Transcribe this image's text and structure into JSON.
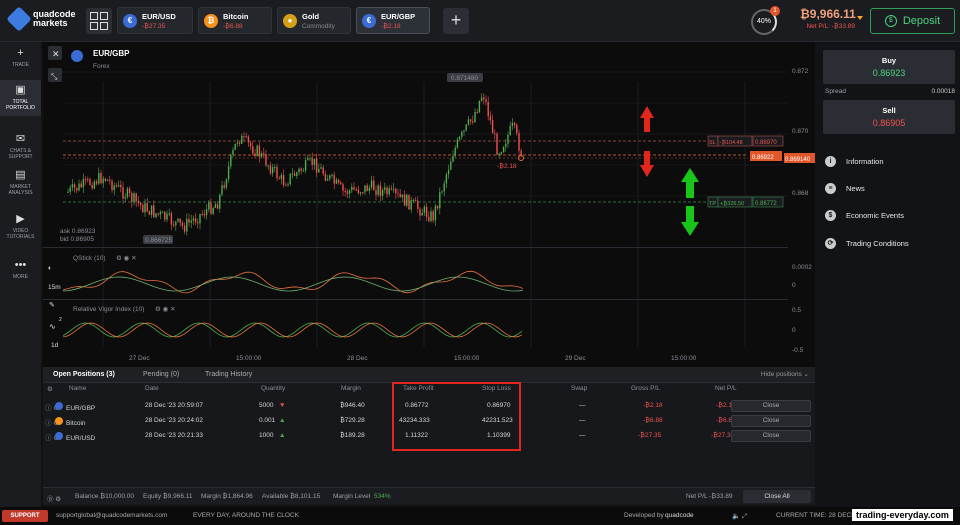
{
  "brand": {
    "line1": "quadcode",
    "line2": "markets"
  },
  "tabs": [
    {
      "name": "EUR/USD",
      "sub": "-₿27.35",
      "tone": "neg",
      "color": "#3b6bd6",
      "glyph": "€"
    },
    {
      "name": "Bitcoin",
      "sub": "-₿6.88",
      "tone": "neg",
      "color": "#f7931a",
      "glyph": "₿"
    },
    {
      "name": "Gold",
      "sub": "Commodity",
      "tone": "muted",
      "color": "#d4a017",
      "glyph": "●"
    },
    {
      "name": "EUR/GBP",
      "sub": "-₿2.18",
      "tone": "neg",
      "color": "#3b6bd6",
      "glyph": "€"
    }
  ],
  "header": {
    "risk": "40%",
    "badge": "1",
    "balance": "₿9,966.11",
    "net_pnl": "Net P/L: -₿33.89",
    "deposit": "Deposit"
  },
  "sidebar": [
    {
      "label": "TRADE",
      "icon": "plus-icon",
      "glyph": "+"
    },
    {
      "label": "TOTAL PORTFOLIO",
      "icon": "briefcase-icon",
      "glyph": "▣",
      "badge": "3"
    },
    {
      "label": "CHATS & SUPPORT",
      "icon": "chat-icon",
      "glyph": "✉"
    },
    {
      "label": "MARKET ANALYSIS",
      "icon": "news-icon",
      "glyph": "▤"
    },
    {
      "label": "VIDEO TUTORIALS",
      "icon": "play-icon",
      "glyph": "▶"
    },
    {
      "label": "MORE",
      "icon": "more-icon",
      "glyph": "•••"
    }
  ],
  "chart": {
    "symbol": "EUR/GBP",
    "category": "Forex",
    "high_marker": "0.871480",
    "low_marker": "0.866725",
    "ask": "ask 0.86923",
    "bid": "bid 0.86905",
    "price_axis": [
      "0.872",
      "0.870",
      "0.868"
    ],
    "sl_label": "SL",
    "sl_value": "-₿104.48",
    "sl_price": "0.86970",
    "current_price": "0.86922",
    "current_price2": "0.869140",
    "tp_label": "TP",
    "tp_value": "+₿326.50",
    "tp_price": "0.86772",
    "position_pnl": "-₿2.18",
    "indicator1": {
      "name": "QStick (10)",
      "axis": [
        "0.0002",
        "0"
      ]
    },
    "indicator2": {
      "name": "Relative Vigor Index (10)",
      "axis": [
        "0.5",
        "0",
        "-0.5"
      ]
    },
    "timeframe": "15m",
    "period": "1d",
    "badge": "2",
    "time_axis": [
      "27 Dec",
      "15:00:00",
      "28 Dec",
      "15:00:00",
      "29 Dec",
      "15:00:00"
    ]
  },
  "positions": {
    "tabs": [
      "Open Positions (3)",
      "Pending (0)",
      "Trading History"
    ],
    "hide": "Hide positions",
    "headers": [
      "Name",
      "Date",
      "Quantity",
      "Margin",
      "Take Profit",
      "Stop Loss",
      "Swap",
      "Gross P/L",
      "Net P/L"
    ],
    "rows": [
      {
        "name": "EUR/GBP",
        "date": "28 Dec '23 20:59:07",
        "qty": "5000",
        "dir": "down",
        "margin": "₿946.40",
        "tp": "0.86772",
        "sl": "0.86970",
        "swap": "—",
        "gross": "-₿2.18",
        "net": "-₿2.18",
        "close": "Close",
        "color": "#3b6bd6"
      },
      {
        "name": "Bitcoin",
        "date": "28 Dec '23 20:24:02",
        "qty": "0.001",
        "dir": "up",
        "margin": "₿729.28",
        "tp": "43234.333",
        "sl": "42231.523",
        "swap": "—",
        "gross": "-₿6.88",
        "net": "-₿6.88",
        "close": "Close",
        "color": "#f7931a"
      },
      {
        "name": "EUR/USD",
        "date": "28 Dec '23 20:21:33",
        "qty": "1000",
        "dir": "up",
        "margin": "₿189.28",
        "tp": "1.11322",
        "sl": "1.10399",
        "swap": "—",
        "gross": "-₿27.35",
        "net": "-₿27.35",
        "close": "Close",
        "color": "#3b6bd6"
      }
    ]
  },
  "footer": {
    "balance": "Balance ₿10,000.00",
    "equity": "Equity ₿9,966.11",
    "margin": "Margin ₿1,864.96",
    "available": "Available ₿8,101.15",
    "margin_level": "Margin Level",
    "margin_level_val": "534%",
    "net": "Net P/L -₿33.89",
    "close_all": "Close All"
  },
  "right": {
    "buy": "Buy",
    "buy_price": "0.86923",
    "spread_label": "Spread",
    "spread": "0.00018",
    "sell": "Sell",
    "sell_price": "0.86905",
    "menu": [
      {
        "label": "Information",
        "icon": "info-icon",
        "glyph": "i"
      },
      {
        "label": "News",
        "icon": "news-icon",
        "glyph": "≡"
      },
      {
        "label": "Economic Events",
        "icon": "dollar-icon",
        "glyph": "$"
      },
      {
        "label": "Trading Conditions",
        "icon": "conditions-icon",
        "glyph": "⟳"
      }
    ]
  },
  "status": {
    "support": "SUPPORT",
    "email": "supportglobal@quadcodemarkets.com",
    "tagline": "EVERY DAY, AROUND THE CLOCK",
    "dev": "Developed by",
    "dev_brand": "quadcode",
    "time": "CURRENT TIME: 28 DECE",
    "watermark": "trading-everyday.com"
  },
  "colors": {
    "accent": "#4cd483",
    "negative": "#ef5350",
    "annotation_red": "#e0261d",
    "annotation_green": "#19c519"
  }
}
